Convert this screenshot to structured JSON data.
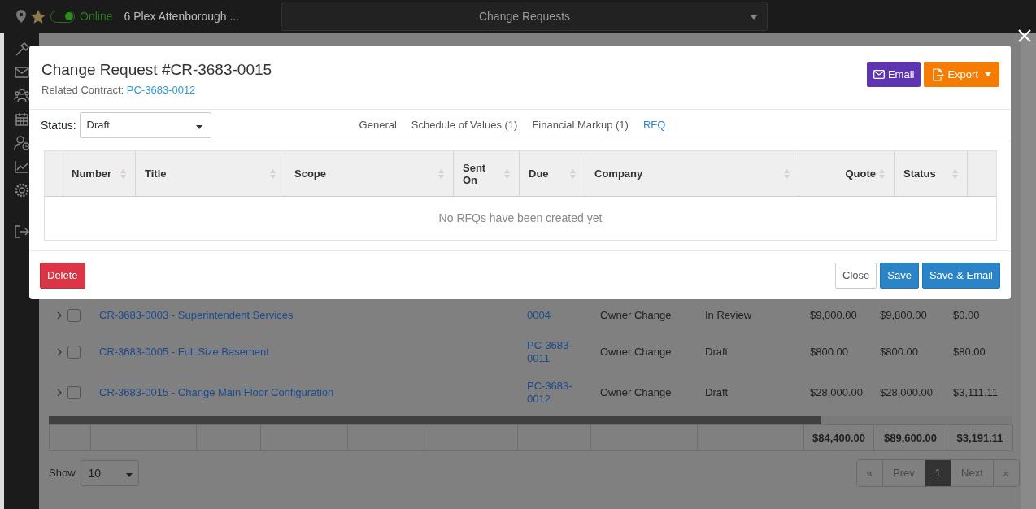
{
  "top_bar": {
    "online": true,
    "online_label": "Online",
    "project": "6 Plex Attenborough ...",
    "module": "Change Requests"
  },
  "records": {
    "rows": [
      {
        "title": "CR-3683-0003 - Superintendent Services",
        "contract": "0004",
        "type": "Owner Change",
        "status": "In Review",
        "amounts": [
          "$9,000.00",
          "$9,800.00",
          "$0.00"
        ],
        "checked": false
      },
      {
        "title": "CR-3683-0005 - Full Size Basement",
        "contract": "PC-3683-0011",
        "type": "Owner Change",
        "status": "Draft",
        "amounts": [
          "$800.00",
          "$800.00",
          "$80.00"
        ],
        "checked": false
      },
      {
        "title": "CR-3683-0015 - Change Main Floor Configuration",
        "contract": "PC-3683-0012",
        "type": "Owner Change",
        "status": "Draft",
        "amounts": [
          "$28,000.00",
          "$28,000.00",
          "$3,111.11"
        ],
        "checked": false
      }
    ],
    "totals": [
      "$84,400.00",
      "$89,600.00",
      "$3,191.11"
    ]
  },
  "page_size": {
    "label": "Show",
    "value": "10"
  },
  "pagination": [
    {
      "label": "«",
      "selected": false,
      "disabled": true
    },
    {
      "label": "Prev",
      "selected": false,
      "disabled": true
    },
    {
      "label": "1",
      "selected": true,
      "disabled": false
    },
    {
      "label": "Next",
      "selected": false,
      "disabled": true
    },
    {
      "label": "»",
      "selected": false,
      "disabled": true
    }
  ],
  "modal": {
    "title": "Change Request #CR-3683-0015",
    "related_label": "Related Contract:",
    "related_link": "PC-3683-0012",
    "actions": [
      {
        "label": "Email",
        "kind": "email"
      },
      {
        "label": "Export",
        "kind": "export"
      }
    ],
    "status_label": "Status:",
    "status_value": "Draft",
    "tabs": [
      {
        "label": "General",
        "selected": false
      },
      {
        "label": "Schedule of Values (1)",
        "selected": false
      },
      {
        "label": "Financial Markup (1)",
        "selected": false
      },
      {
        "label": "RFQ",
        "selected": true
      }
    ],
    "columns": [
      {
        "label": "Number",
        "numeric": false
      },
      {
        "label": "Title",
        "numeric": false
      },
      {
        "label": "Scope",
        "numeric": false
      },
      {
        "label": "Sent On",
        "numeric": false
      },
      {
        "label": "Due",
        "numeric": false
      },
      {
        "label": "Company",
        "numeric": false
      },
      {
        "label": "Quote",
        "numeric": true
      },
      {
        "label": "Status",
        "numeric": false
      }
    ],
    "empty_message": "No RFQs have been created yet",
    "footer_buttons": [
      {
        "label": "Delete",
        "kind": "danger"
      },
      {
        "label": "Close",
        "kind": "light"
      },
      {
        "label": "Save",
        "kind": "primary"
      },
      {
        "label": "Save & Email",
        "kind": "primary"
      }
    ]
  }
}
